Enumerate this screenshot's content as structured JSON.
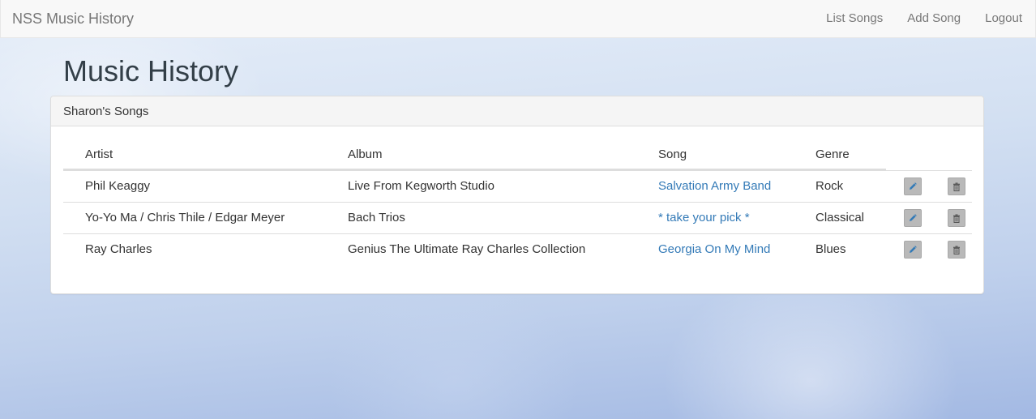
{
  "navbar": {
    "brand": "NSS Music History",
    "links": [
      "List Songs",
      "Add Song",
      "Logout"
    ]
  },
  "page": {
    "title": "Music History"
  },
  "panel": {
    "heading": "Sharon's Songs",
    "columns": [
      "Artist",
      "Album",
      "Song",
      "Genre"
    ],
    "rows": [
      {
        "artist": "Phil Keaggy",
        "album": "Live From Kegworth Studio",
        "song": "Salvation Army Band",
        "genre": "Rock"
      },
      {
        "artist": "Yo-Yo Ma / Chris Thile / Edgar Meyer",
        "album": "Bach Trios",
        "song": "* take your pick *",
        "genre": "Classical"
      },
      {
        "artist": "Ray Charles",
        "album": "Genius The Ultimate Ray Charles Collection",
        "song": "Georgia On My Mind",
        "genre": "Blues"
      }
    ],
    "row_actions": {
      "edit_icon": "pencil-icon",
      "delete_icon": "trash-icon"
    }
  },
  "colors": {
    "link": "#337ab7",
    "navbar_bg": "#f8f8f8",
    "nav_text": "#777777",
    "icon_button_bg": "#b9b9b9"
  }
}
